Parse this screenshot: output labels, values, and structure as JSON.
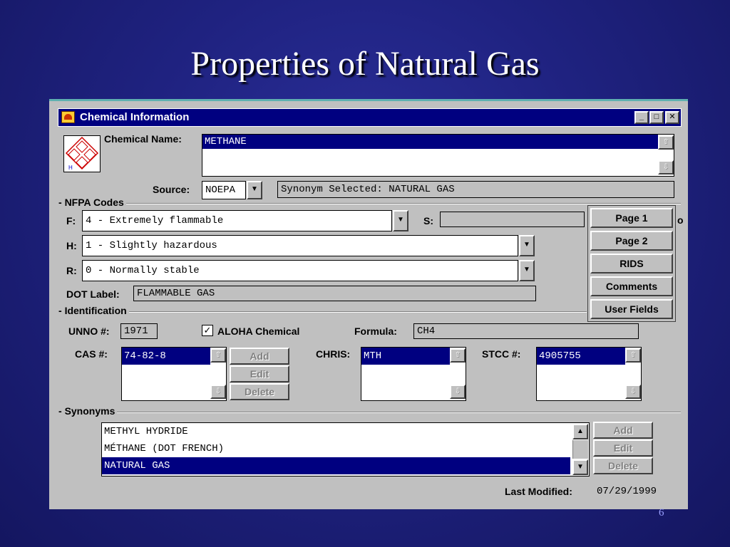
{
  "slide": {
    "title": "Properties of Natural Gas",
    "page_number": "6"
  },
  "window": {
    "title": "Chemical Information"
  },
  "chemical": {
    "name_label": "Chemical Name:",
    "name_value": "METHANE"
  },
  "source": {
    "label": "Source:",
    "value": "NOEPA",
    "synonym_selected": "Synonym Selected: NATURAL GAS"
  },
  "nfpa": {
    "group_label": "NFPA Codes",
    "f_label": "F:",
    "f_value": "4 - Extremely flammable",
    "s_label": "S:",
    "s_value": "",
    "h_label": "H:",
    "h_value": "1 - Slightly hazardous",
    "r_label": "R:",
    "r_value": "0 - Normally stable",
    "dot_label": "DOT Label:",
    "dot_value": "FLAMMABLE GAS"
  },
  "pages": {
    "page1": "Page 1",
    "page2": "Page 2",
    "rids": "RIDS",
    "comments": "Comments",
    "user_fields": "User Fields",
    "cut_text": "o"
  },
  "identification": {
    "group_label": "Identification",
    "unno_label": "UNNO #:",
    "unno_value": "1971",
    "aloha_label": "ALOHA Chemical",
    "aloha_checked": true,
    "formula_label": "Formula:",
    "formula_value": "CH4",
    "cas_label": "CAS #:",
    "cas_value": "74-82-8",
    "chris_label": "CHRIS:",
    "chris_value": "MTH",
    "stcc_label": "STCC #:",
    "stcc_value": "4905755",
    "add": "Add",
    "edit": "Edit",
    "delete": "Delete"
  },
  "synonyms": {
    "group_label": "Synonyms",
    "items": [
      "METHYL HYDRIDE",
      "MÉTHANE (DOT FRENCH)",
      "NATURAL GAS"
    ],
    "selected_index": 2,
    "add": "Add",
    "edit": "Edit",
    "delete": "Delete"
  },
  "footer": {
    "last_modified_label": "Last Modified:",
    "last_modified_value": "07/29/1999"
  },
  "icons": {
    "up": "▲",
    "down": "▼",
    "small_up": "⇧",
    "small_down": "⇩",
    "minimize": "_",
    "maximize": "□",
    "close": "✕",
    "check": "✓"
  }
}
